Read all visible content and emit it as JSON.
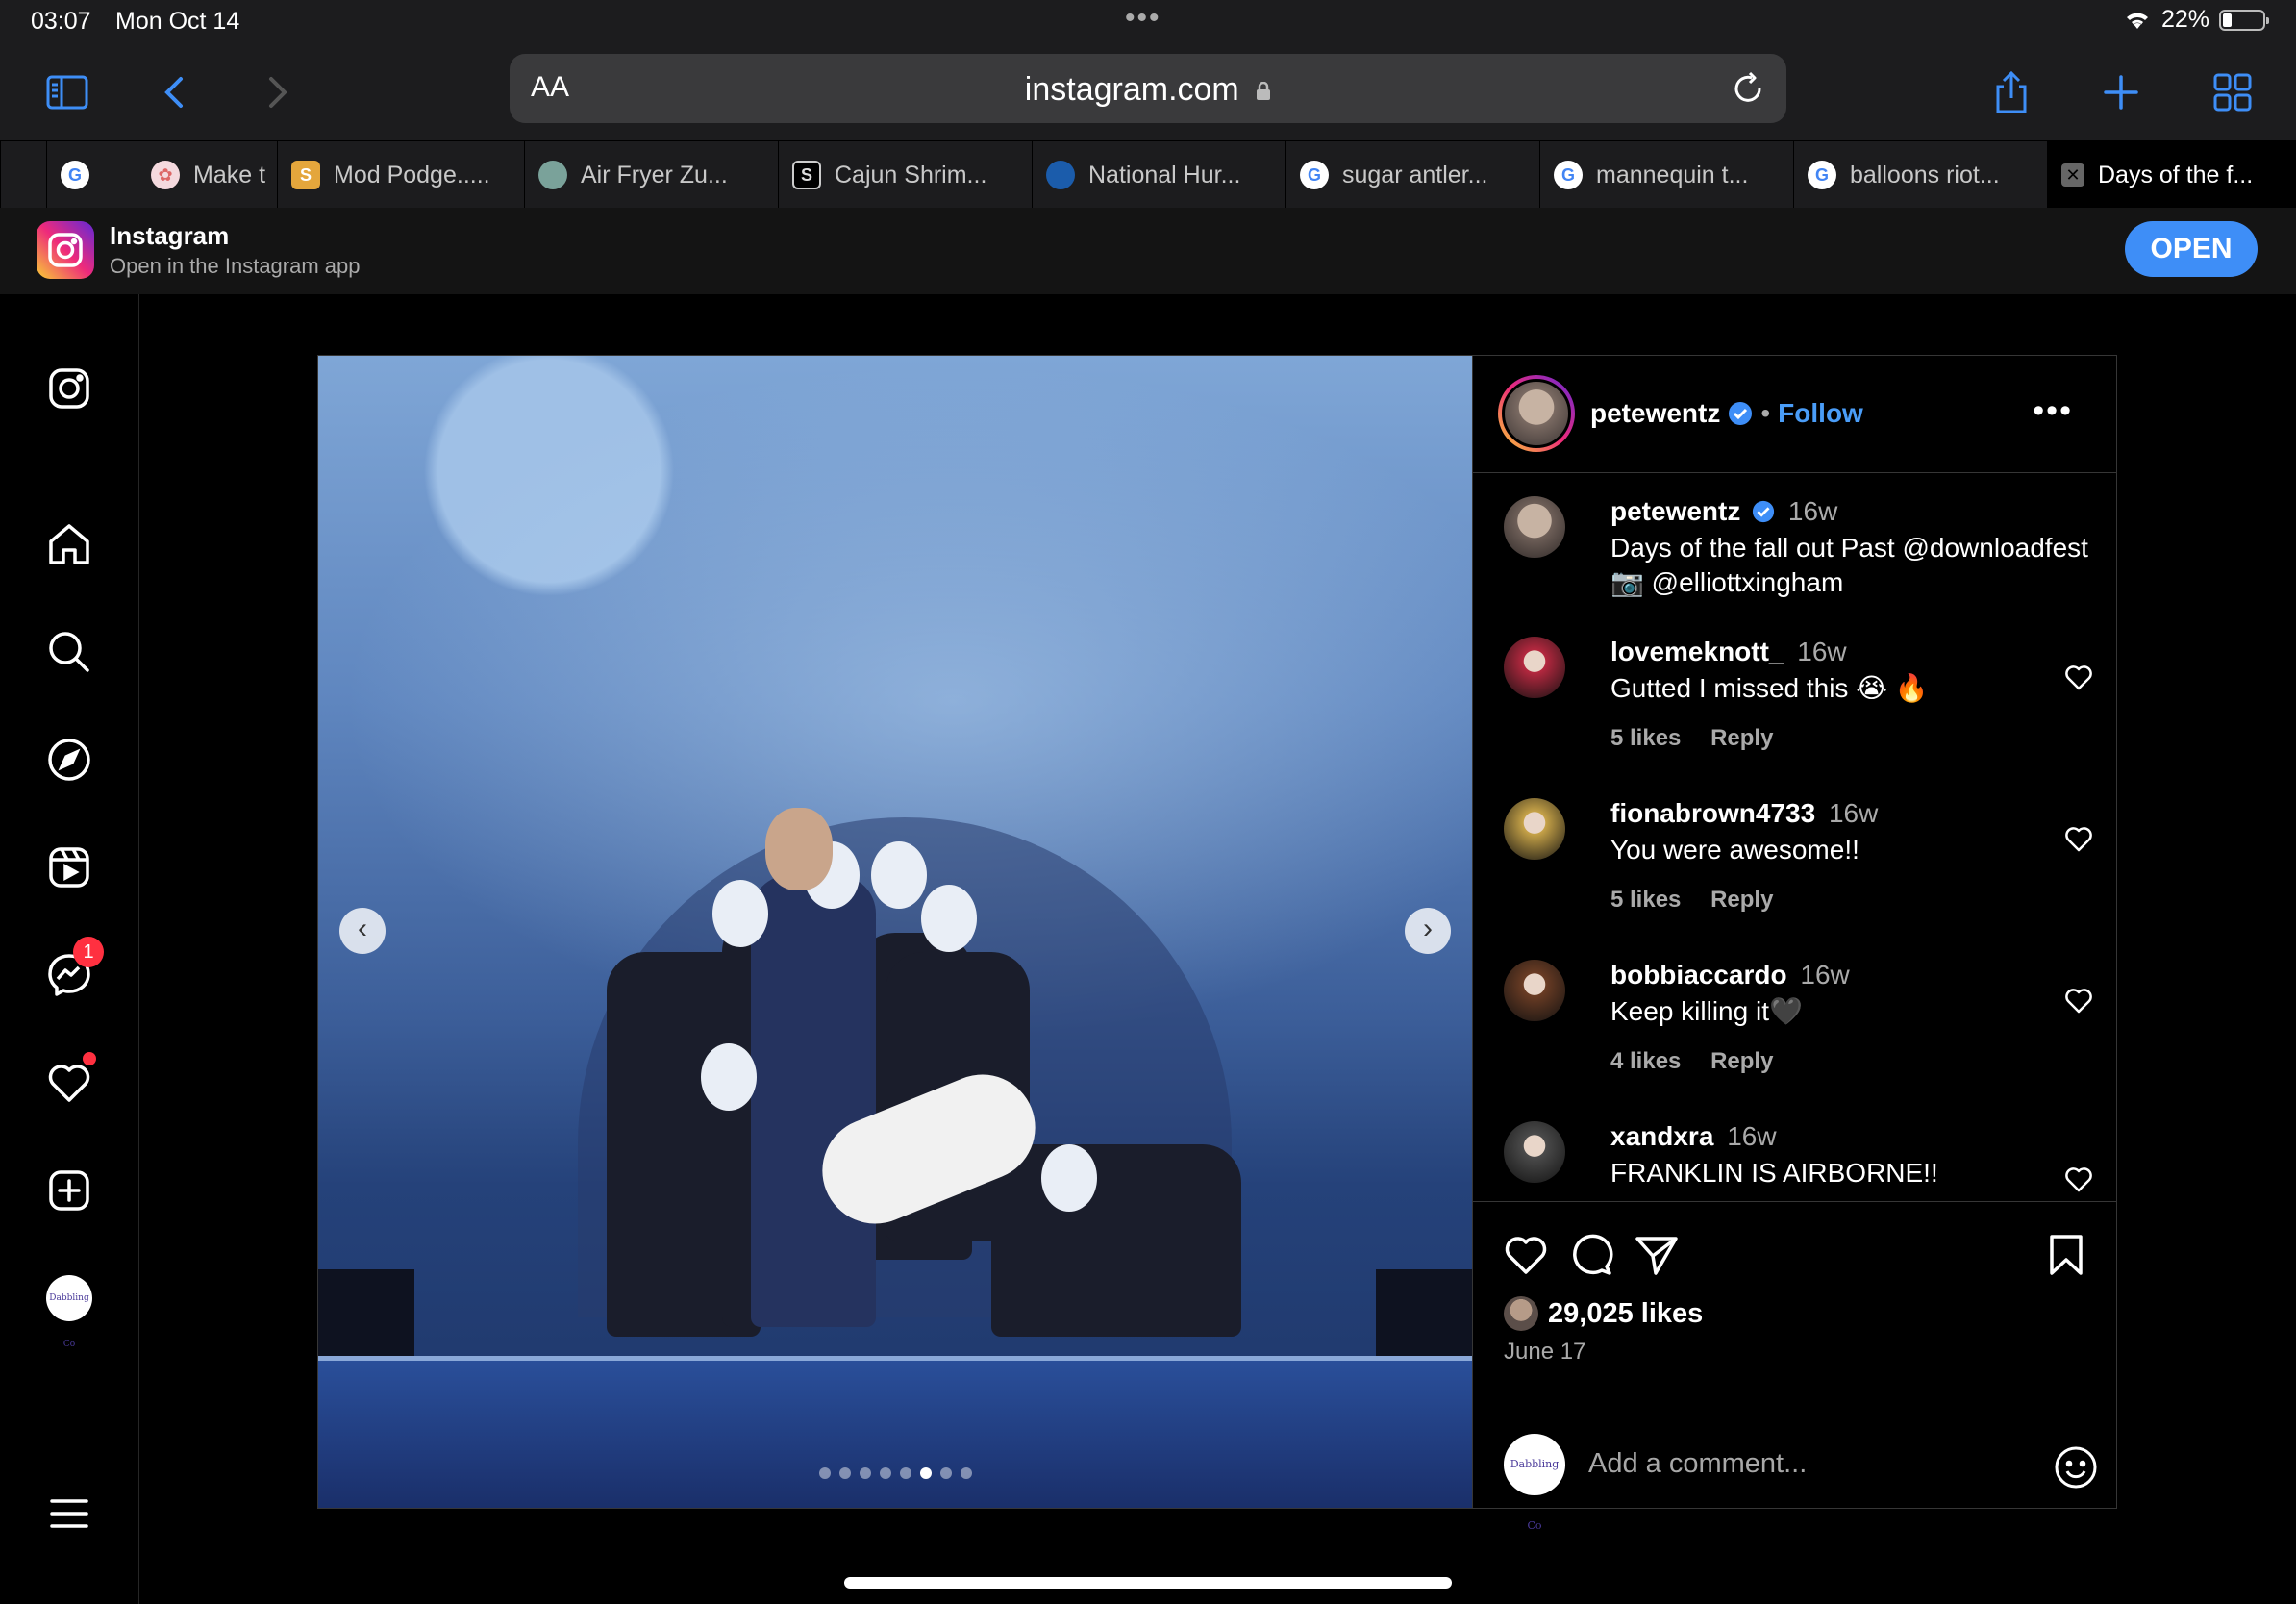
{
  "status": {
    "time": "03:07",
    "date": "Mon Oct 14",
    "battery": "22%",
    "battery_level": 0.22
  },
  "toolbar": {
    "aa": "AA",
    "url": "instagram.com"
  },
  "tabs": [
    {
      "label": "",
      "favicon": "google-icon"
    },
    {
      "label": "Make t",
      "favicon": "pink-circle-icon"
    },
    {
      "label": "Mod Podge.....",
      "favicon": "mod-podge-icon"
    },
    {
      "label": "Air Fryer Zu...",
      "favicon": "air-fryer-icon"
    },
    {
      "label": "Cajun Shrim...",
      "favicon": "s-icon"
    },
    {
      "label": "National Hur...",
      "favicon": "noaa-icon"
    },
    {
      "label": "sugar antler...",
      "favicon": "google-icon"
    },
    {
      "label": "mannequin t...",
      "favicon": "google-icon"
    },
    {
      "label": "balloons riot...",
      "favicon": "google-icon"
    },
    {
      "label": "Days of the f...",
      "favicon": "close-icon"
    }
  ],
  "banner": {
    "title": "Instagram",
    "subtitle": "Open in the Instagram app",
    "open_label": "OPEN"
  },
  "sidebar": {
    "messages_badge": "1",
    "profile_avatar_text": "Dabbling Co"
  },
  "post": {
    "username": "petewentz",
    "separator": "•",
    "follow_label": "Follow",
    "more_label": "•••",
    "carousel": {
      "count": 8,
      "active_index": 5
    },
    "caption": {
      "user": "petewentz",
      "time": "16w",
      "line1": "Days of the fall out Past @downloadfest",
      "line2": "📷 @elliottxingham"
    },
    "comments": [
      {
        "user": "lovemeknott_",
        "time": "16w",
        "text": "Gutted I missed this 😭 🔥",
        "likes": "5 likes",
        "reply": "Reply",
        "avatar_color": "#b5283f"
      },
      {
        "user": "fionabrown4733",
        "time": "16w",
        "text": "You were awesome!!",
        "likes": "5 likes",
        "reply": "Reply",
        "avatar_color": "#c7a348"
      },
      {
        "user": "bobbiaccardo",
        "time": "16w",
        "text": "Keep killing it🖤",
        "likes": "4 likes",
        "reply": "Reply",
        "avatar_color": "#6a3c24"
      },
      {
        "user": "xandxra",
        "time": "16w",
        "text": "FRANKLIN IS AIRBORNE!!",
        "likes": "",
        "reply": "",
        "avatar_color": "#4b4b4b"
      }
    ],
    "likes": "29,025 likes",
    "date": "June 17",
    "add_comment_placeholder": "Add a comment...",
    "commenter_avatar_text": "Dabbling Co"
  },
  "colors": {
    "accent": "#3e8ef7",
    "follow": "#4a9df8",
    "badge": "#ff3040"
  }
}
